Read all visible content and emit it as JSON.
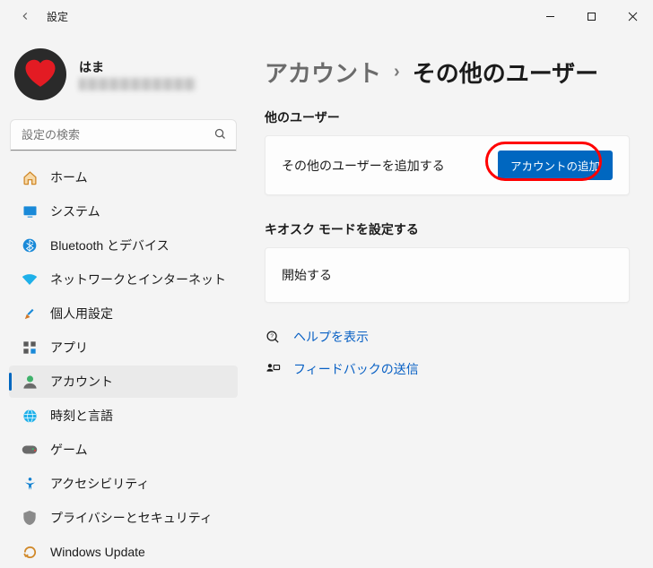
{
  "window": {
    "title": "設定"
  },
  "user": {
    "name": "はま"
  },
  "search": {
    "placeholder": "設定の検索"
  },
  "nav": {
    "home": "ホーム",
    "system": "システム",
    "bluetooth": "Bluetooth とデバイス",
    "network": "ネットワークとインターネット",
    "personal": "個人用設定",
    "apps": "アプリ",
    "accounts": "アカウント",
    "time": "時刻と言語",
    "gaming": "ゲーム",
    "access": "アクセシビリティ",
    "privacy": "プライバシーとセキュリティ",
    "update": "Windows Update"
  },
  "crumb": {
    "parent": "アカウント",
    "current": "その他のユーザー"
  },
  "sections": {
    "other_users_title": "他のユーザー",
    "add_user_text": "その他のユーザーを追加する",
    "add_user_button": "アカウントの追加",
    "kiosk_title": "キオスク モードを設定する",
    "kiosk_action": "開始する"
  },
  "links": {
    "help": "ヘルプを表示",
    "feedback": "フィードバックの送信"
  }
}
